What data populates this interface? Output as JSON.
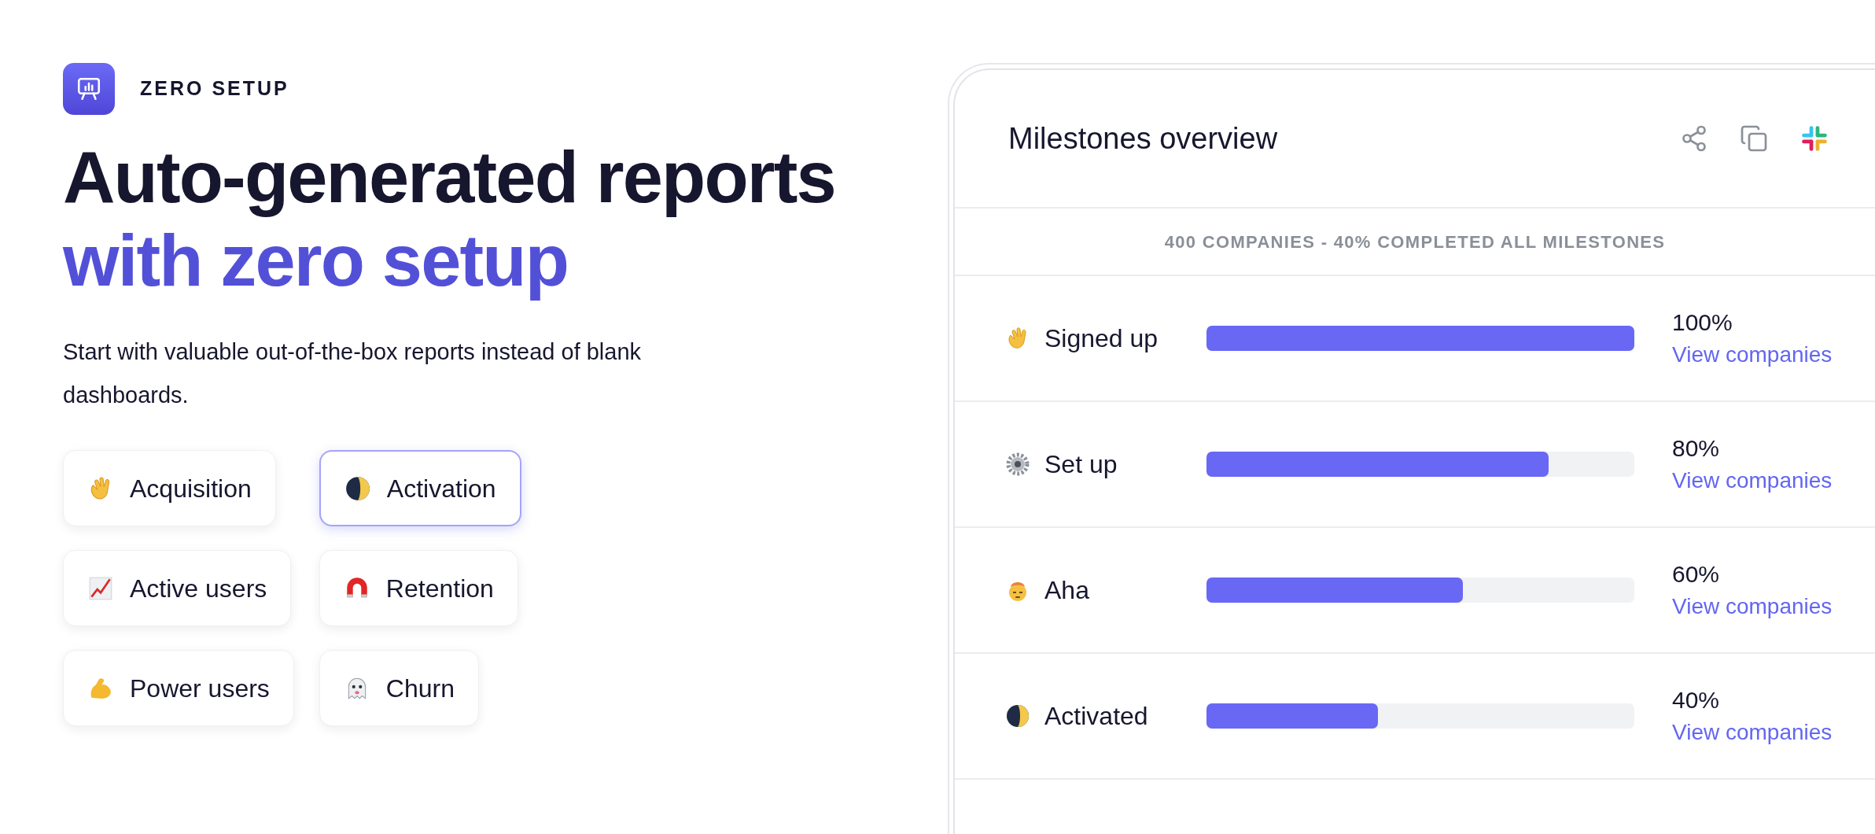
{
  "badge": {
    "label": "ZERO SETUP"
  },
  "heading": {
    "line_1": "Auto-generated reports",
    "line_2": "with zero setup"
  },
  "description": "Start with valuable out-of-the-box reports instead of blank dashboards.",
  "report_types": [
    {
      "label": "Acquisition",
      "kind": "wave",
      "selected": false
    },
    {
      "label": "Activation",
      "kind": "moon",
      "selected": true
    },
    {
      "label": "Active users",
      "kind": "chart",
      "selected": false
    },
    {
      "label": "Retention",
      "kind": "magnet",
      "selected": false
    },
    {
      "label": "Power users",
      "kind": "muscle",
      "selected": false
    },
    {
      "label": "Churn",
      "kind": "ghost",
      "selected": false
    }
  ],
  "card": {
    "title": "Milestones overview",
    "summary": "400 COMPANIES - 40% COMPLETED ALL MILESTONES",
    "milestones": [
      {
        "label": "Signed up",
        "kind": "wave",
        "level": 1,
        "percent": "100%",
        "link": "View companies"
      },
      {
        "label": "Set up",
        "kind": "gear",
        "level": 0.8,
        "percent": "80%",
        "link": "View companies"
      },
      {
        "label": "Aha",
        "kind": "mindblown",
        "level": 0.6,
        "percent": "60%",
        "link": "View companies"
      },
      {
        "label": "Activated",
        "kind": "moon",
        "level": 0.4,
        "percent": "40%",
        "link": "View companies"
      }
    ]
  }
}
